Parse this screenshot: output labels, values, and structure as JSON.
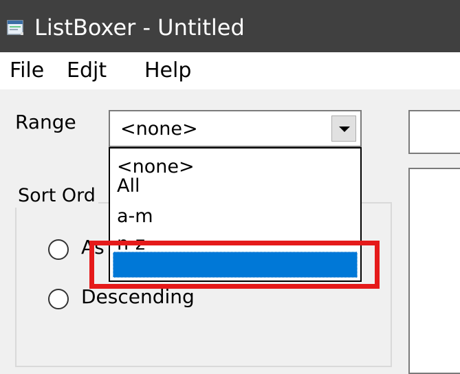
{
  "window": {
    "title": "ListBoxer - Untitled",
    "app_icon": "listboxer-app-icon"
  },
  "menu": {
    "items": [
      {
        "label": "File"
      },
      {
        "label": "Edjt"
      },
      {
        "label": "Help"
      }
    ]
  },
  "range": {
    "label": "Range",
    "selected": "<none>",
    "dropdown_icon": "chevron-down-icon",
    "options": [
      {
        "label": "<none>"
      },
      {
        "label": "All"
      },
      {
        "label": "a-m"
      },
      {
        "label": "n-z"
      },
      {
        "label": ""
      }
    ],
    "highlighted_option_index": 4
  },
  "sort_order": {
    "group_label": "Sort Ord",
    "options": [
      {
        "label": "As"
      },
      {
        "label": "Descending"
      }
    ]
  },
  "colors": {
    "titlebar": "#404040",
    "selection": "#0078d7",
    "annotation": "#e51a1a"
  }
}
